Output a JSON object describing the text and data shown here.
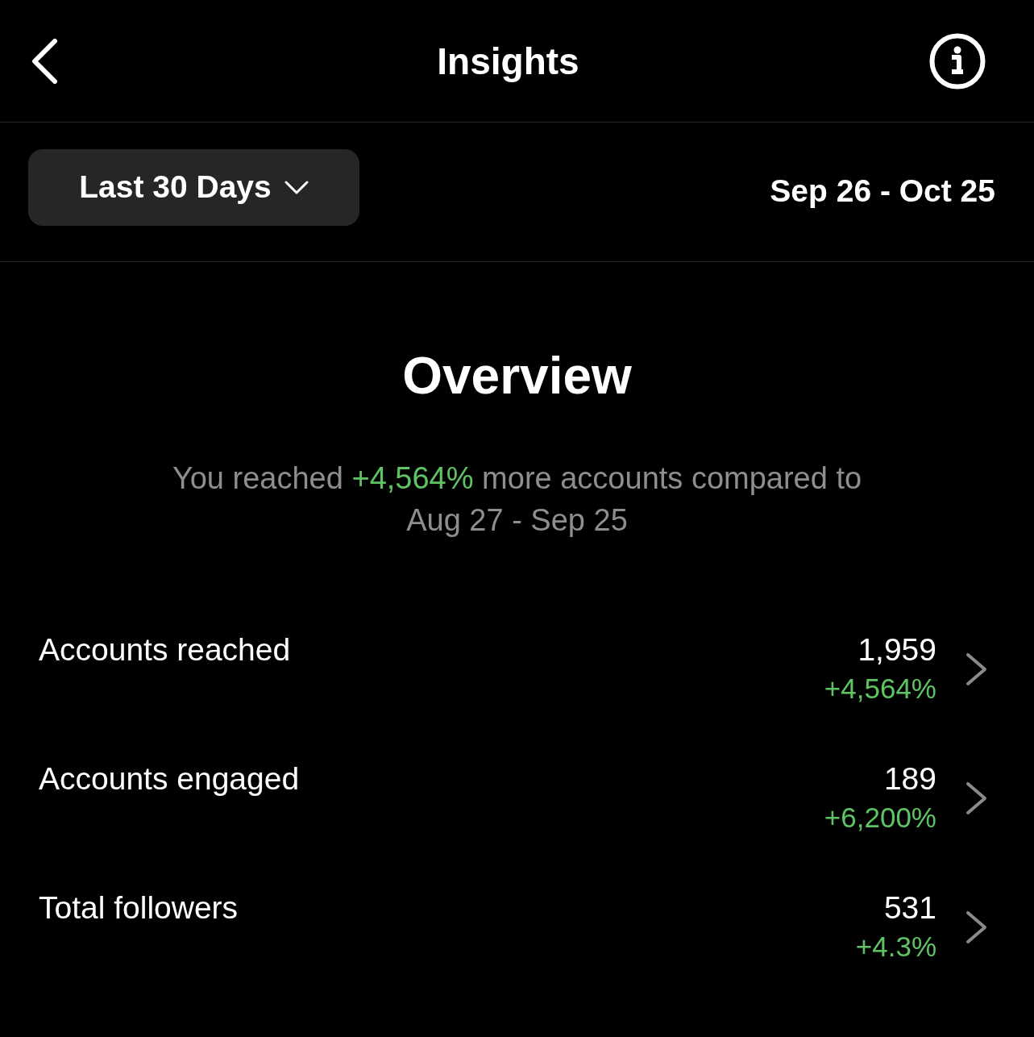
{
  "header": {
    "title": "Insights"
  },
  "filter": {
    "period": "Last 30 Days",
    "date_range": "Sep 26 - Oct 25"
  },
  "overview": {
    "title": "Overview",
    "summary": {
      "before": "You reached",
      "highlight": "+4,564%",
      "after": "more accounts compared to",
      "range": "Aug 27 - Sep 25"
    }
  },
  "metrics": [
    {
      "label": "Accounts reached",
      "value": "1,959",
      "change": "+4,564%"
    },
    {
      "label": "Accounts engaged",
      "value": "189",
      "change": "+6,200%"
    },
    {
      "label": "Total followers",
      "value": "531",
      "change": "+4.3%"
    }
  ]
}
